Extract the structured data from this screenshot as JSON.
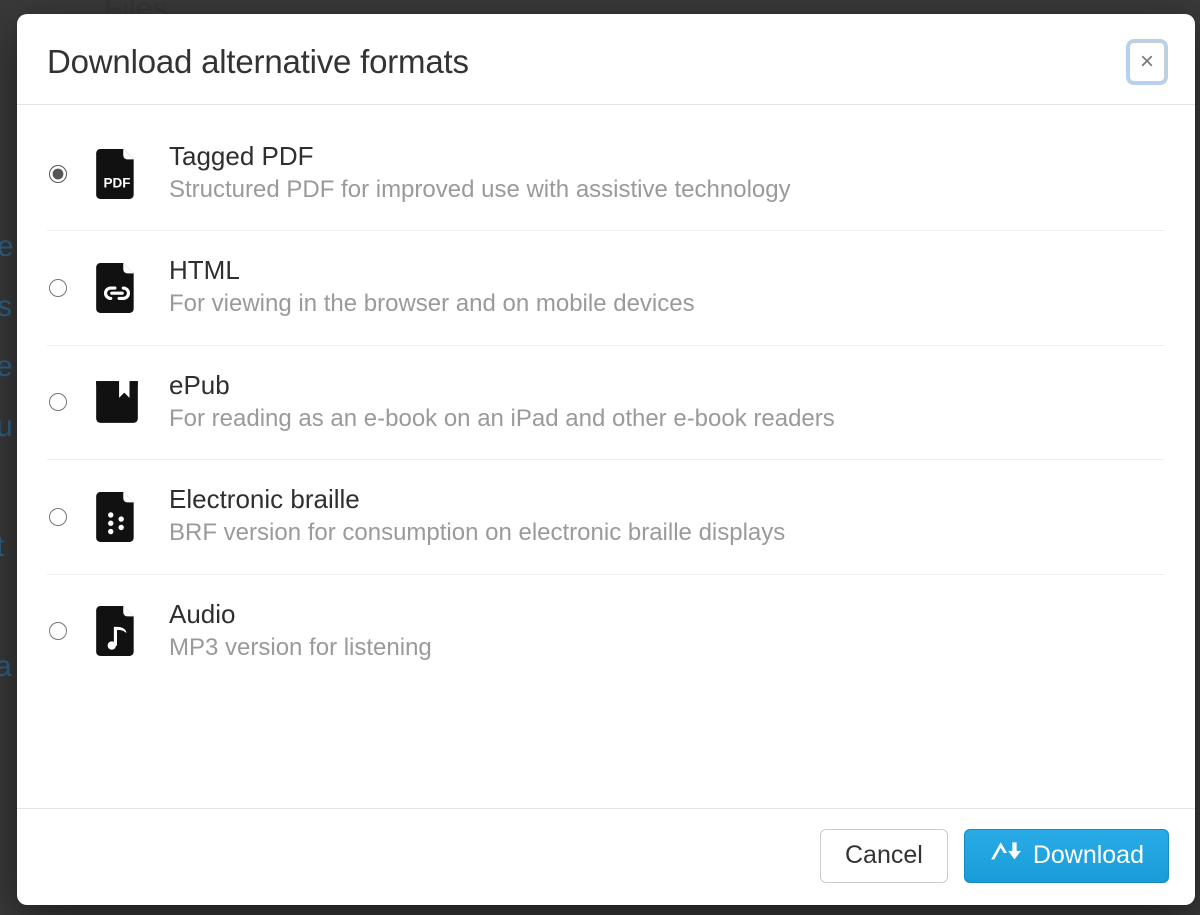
{
  "dialog": {
    "title": "Download alternative formats",
    "close_glyph": "×"
  },
  "formats": [
    {
      "key": "tagged-pdf",
      "title": "Tagged PDF",
      "desc": "Structured PDF for improved use with assistive technology",
      "selected": true,
      "icon": "pdf-file-icon"
    },
    {
      "key": "html",
      "title": "HTML",
      "desc": "For viewing in the browser and on mobile devices",
      "selected": false,
      "icon": "html-link-file-icon"
    },
    {
      "key": "epub",
      "title": "ePub",
      "desc": "For reading as an e-book on an iPad and other e-book readers",
      "selected": false,
      "icon": "epub-book-icon"
    },
    {
      "key": "braille",
      "title": "Electronic braille",
      "desc": "BRF version for consumption on electronic braille displays",
      "selected": false,
      "icon": "braille-file-icon"
    },
    {
      "key": "audio",
      "title": "Audio",
      "desc": "MP3 version for listening",
      "selected": false,
      "icon": "audio-file-icon"
    }
  ],
  "footer": {
    "cancel_label": "Cancel",
    "download_label": "Download"
  },
  "icons": {
    "download_arrow": "download-arrow-icon"
  }
}
